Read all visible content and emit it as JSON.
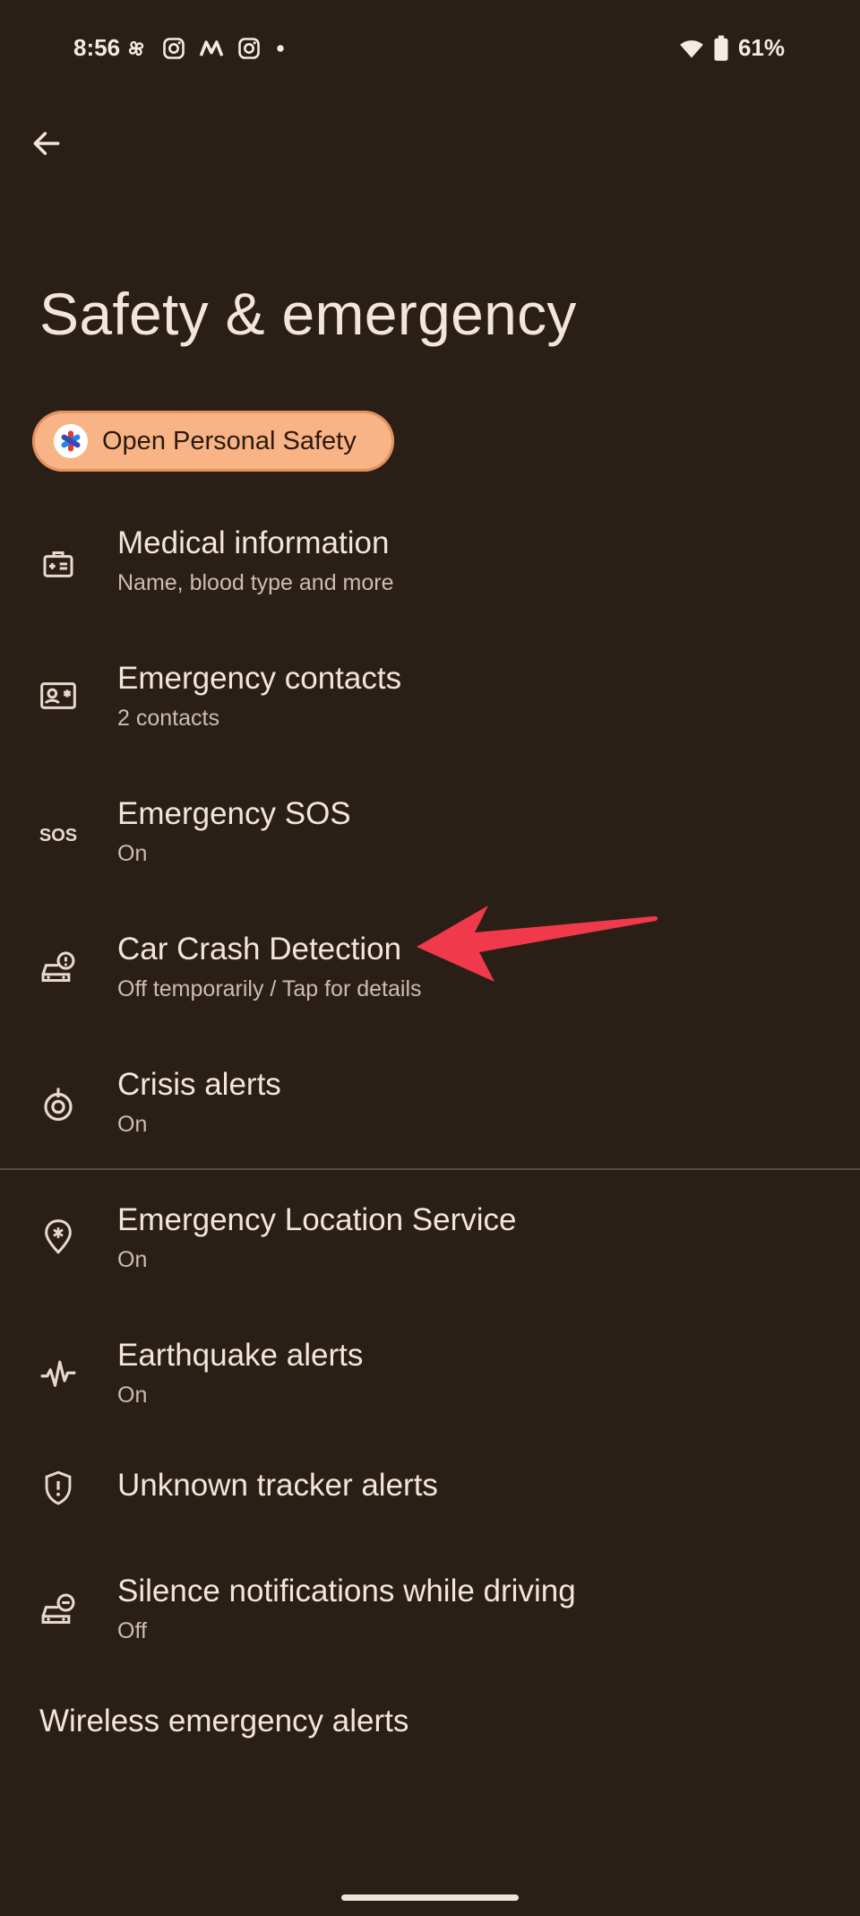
{
  "status_bar": {
    "time": "8:56",
    "battery": "61%"
  },
  "page": {
    "title": "Safety & emergency"
  },
  "personal_safety_button": {
    "label": "Open Personal Safety"
  },
  "items": [
    {
      "title": "Medical information",
      "subtitle": "Name, blood type and more",
      "icon": "medical-kit-icon"
    },
    {
      "title": "Emergency contacts",
      "subtitle": "2 contacts",
      "icon": "contact-card-icon"
    },
    {
      "title": "Emergency SOS",
      "subtitle": "On",
      "icon": "sos-icon"
    },
    {
      "title": "Car Crash Detection",
      "subtitle": "Off temporarily / Tap for details",
      "icon": "car-crash-icon"
    },
    {
      "title": "Crisis alerts",
      "subtitle": "On",
      "icon": "crisis-alert-icon"
    },
    {
      "title": "Emergency Location Service",
      "subtitle": "On",
      "icon": "location-asterisk-icon"
    },
    {
      "title": "Earthquake alerts",
      "subtitle": "On",
      "icon": "seismic-wave-icon"
    },
    {
      "title": "Unknown tracker alerts",
      "subtitle": "",
      "icon": "shield-alert-icon"
    },
    {
      "title": "Silence notifications while driving",
      "subtitle": "Off",
      "icon": "car-minus-icon"
    }
  ],
  "wireless_alerts": {
    "label": "Wireless emergency alerts"
  },
  "colors": {
    "background": "#2a1f17",
    "accent_button": "#f8b486",
    "annotation_arrow": "#f0394a"
  }
}
